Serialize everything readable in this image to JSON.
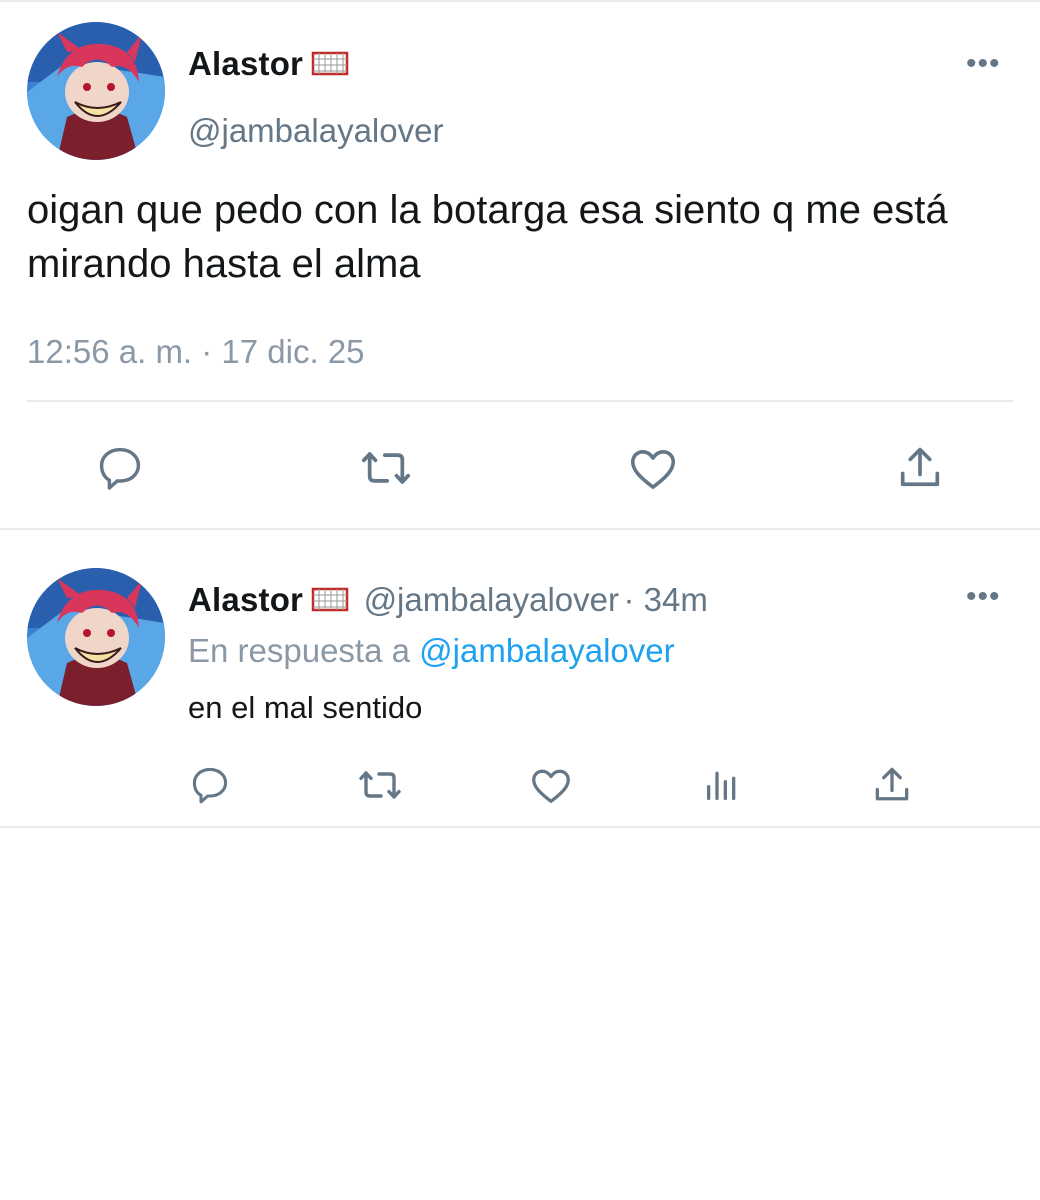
{
  "tweet": {
    "author_name": "Alastor",
    "author_handle": "@jambalayalover",
    "text": "oigan que pedo con la botarga esa siento q me está mirando hasta el alma",
    "timestamp": "12:56 a. m. · 17 dic. 25",
    "badge_icon": "goal-net-emoji",
    "actions": [
      "reply-icon",
      "retweet-icon",
      "like-icon",
      "share-icon"
    ]
  },
  "reply": {
    "author_name": "Alastor",
    "author_handle": "@jambalayalover",
    "age": "· 34m",
    "in_reply_prefix": "En respuesta a",
    "in_reply_handle": "@jambalayalover",
    "text": "en el mal sentido",
    "actions": [
      "reply-icon",
      "retweet-icon",
      "like-icon",
      "analytics-icon",
      "share-icon"
    ]
  },
  "colors": {
    "text_primary": "#14171a",
    "text_secondary": "#657786",
    "link": "#1da1f2",
    "divider": "#e6ecf0"
  }
}
